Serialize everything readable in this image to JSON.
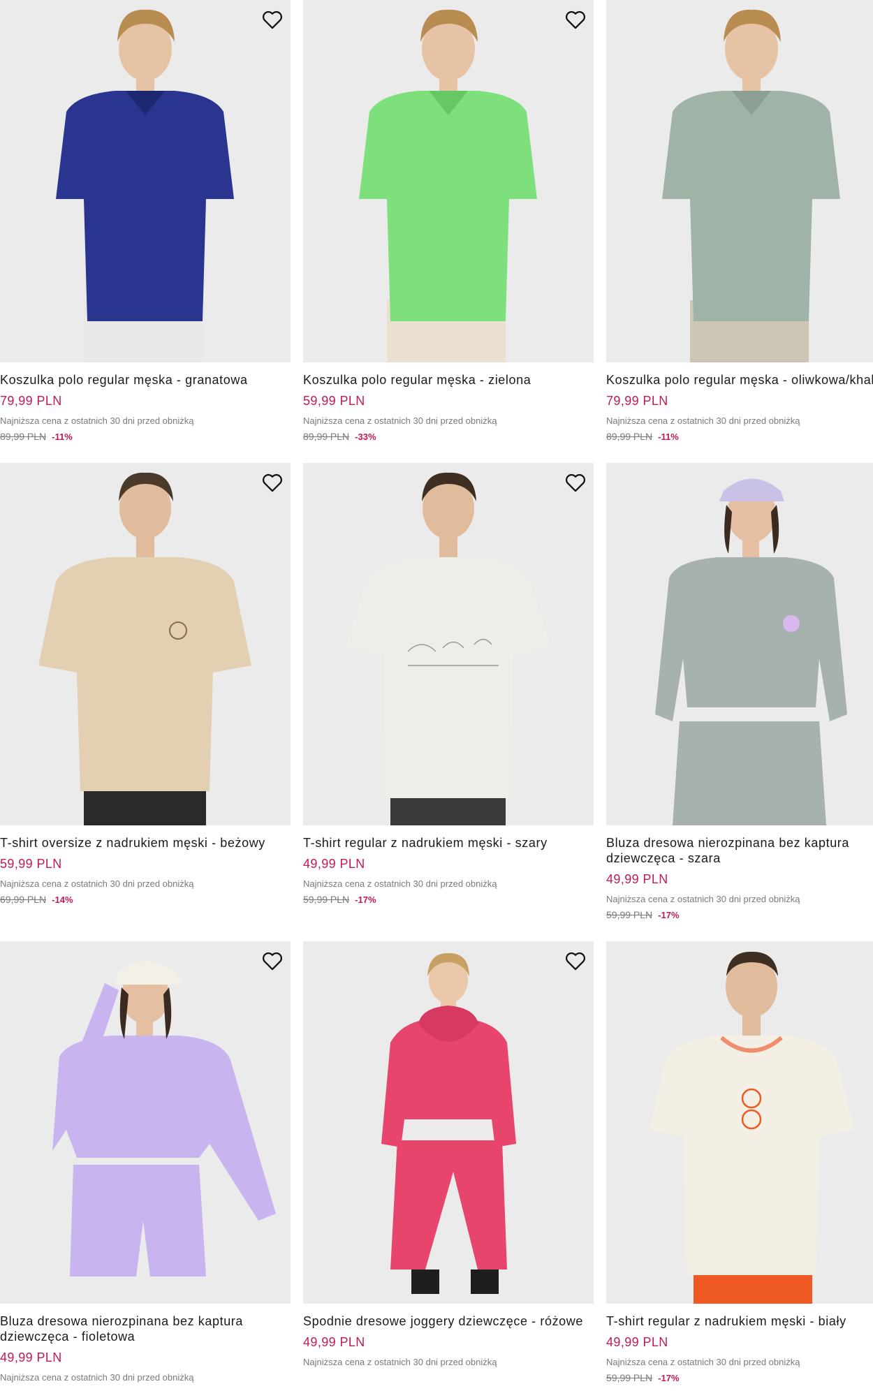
{
  "lowest_price_note": "Najniższa cena z ostatnich 30 dni przed obniżką",
  "products": [
    {
      "name": "Koszulka polo regular męska - granatowa",
      "price": "79,99 PLN",
      "old_price": "89,99 PLN",
      "discount": "-11%",
      "color": "#2a3590",
      "favorite_icon": "heart-outline-icon"
    },
    {
      "name": "Koszulka polo regular męska - zielona",
      "price": "59,99 PLN",
      "old_price": "89,99 PLN",
      "discount": "-33%",
      "color": "#7ee07c",
      "favorite_icon": "heart-outline-icon"
    },
    {
      "name": "Koszulka polo regular męska - oliwkowa/khaki",
      "price": "79,99 PLN",
      "old_price": "89,99 PLN",
      "discount": "-11%",
      "color": "#9fb3a7",
      "favorite_icon": "heart-outline-icon"
    },
    {
      "name": "T-shirt oversize z nadrukiem męski - beżowy",
      "price": "59,99 PLN",
      "old_price": "69,99 PLN",
      "discount": "-14%",
      "color": "#e3d0b3",
      "favorite_icon": "heart-outline-icon"
    },
    {
      "name": "T-shirt regular z nadrukiem męski - szary",
      "price": "49,99 PLN",
      "old_price": "59,99 PLN",
      "discount": "-17%",
      "color": "#efede8",
      "favorite_icon": "heart-outline-icon"
    },
    {
      "name": "Bluza dresowa nierozpinana bez kaptura dziewczęca - szara",
      "price": "49,99 PLN",
      "old_price": "59,99 PLN",
      "discount": "-17%",
      "color": "#a7b2ae",
      "favorite_icon": "heart-outline-icon"
    },
    {
      "name": "Bluza dresowa nierozpinana bez kaptura dziewczęca - fioletowa",
      "price": "49,99 PLN",
      "old_price": "",
      "discount": "",
      "color": "#c8b4ee",
      "favorite_icon": "heart-outline-icon"
    },
    {
      "name": "Spodnie dresowe joggery dziewczęce - różowe",
      "price": "49,99 PLN",
      "old_price": "",
      "discount": "",
      "color": "#e8456c",
      "favorite_icon": "heart-outline-icon"
    },
    {
      "name": "T-shirt regular z nadrukiem męski - biały",
      "price": "49,99 PLN",
      "old_price": "59,99 PLN",
      "discount": "-17%",
      "color": "#f4efe4",
      "favorite_icon": "heart-outline-icon"
    }
  ]
}
